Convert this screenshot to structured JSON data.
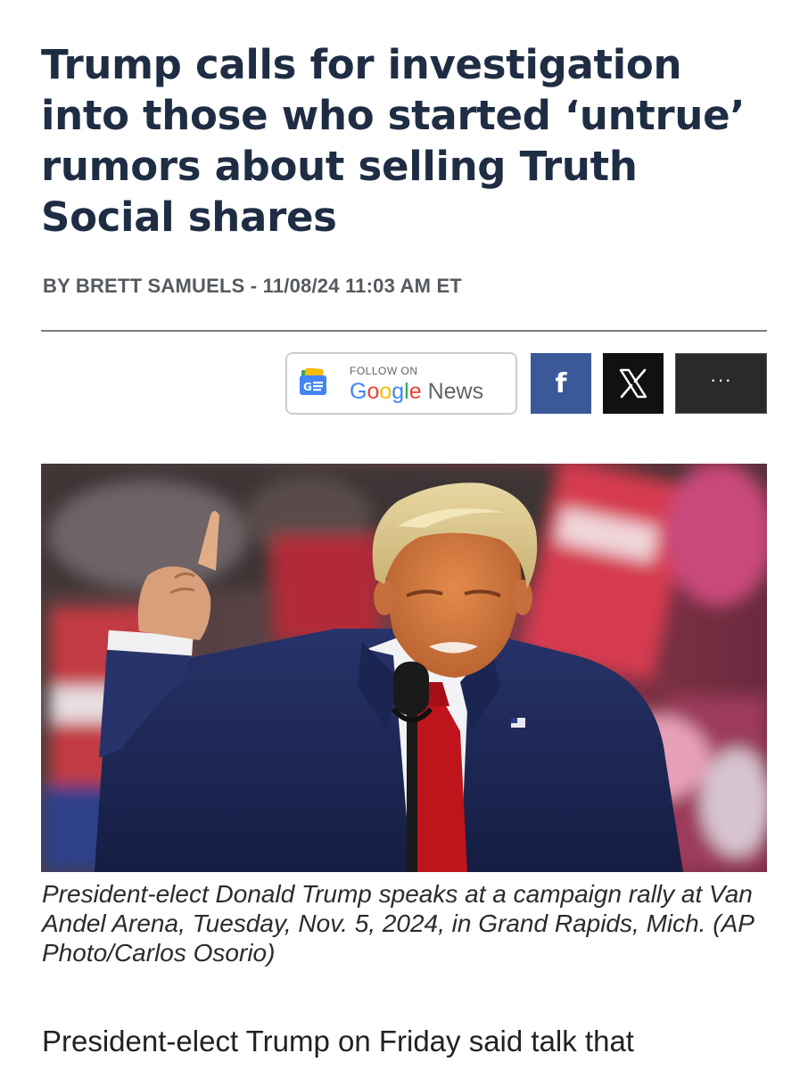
{
  "article": {
    "headline": "Trump calls for investigation into those who started ‘untrue’ rumors about selling Truth Social shares",
    "byline": "BY BRETT SAMUELS - 11/08/24 11:03 AM ET",
    "caption": "President-elect Donald Trump speaks at a campaign rally at Van Andel Arena, Tuesday, Nov. 5, 2024, in Grand Rapids, Mich. (AP Photo/Carlos Osorio)",
    "body_first_line": "President-elect Trump on Friday said talk that"
  },
  "share": {
    "follow_label": "FOLLOW ON",
    "google_news_brand_g": "G",
    "google_news_brand_o1": "o",
    "google_news_brand_o2": "o",
    "google_news_brand_g2": "g",
    "google_news_brand_l": "l",
    "google_news_brand_e": "e",
    "google_news_news": " News",
    "google_icon_text": "G☰",
    "facebook_label": "f",
    "more_label": "···",
    "icons": {
      "google_news": "google-news-icon",
      "facebook": "facebook-icon",
      "x": "x-logo-icon",
      "more": "more-dots-icon"
    }
  },
  "colors": {
    "headline": "#1f2d44",
    "facebook": "#3b5998",
    "x": "#111111",
    "tie": "#c0141c",
    "suit": "#1e2a55"
  }
}
